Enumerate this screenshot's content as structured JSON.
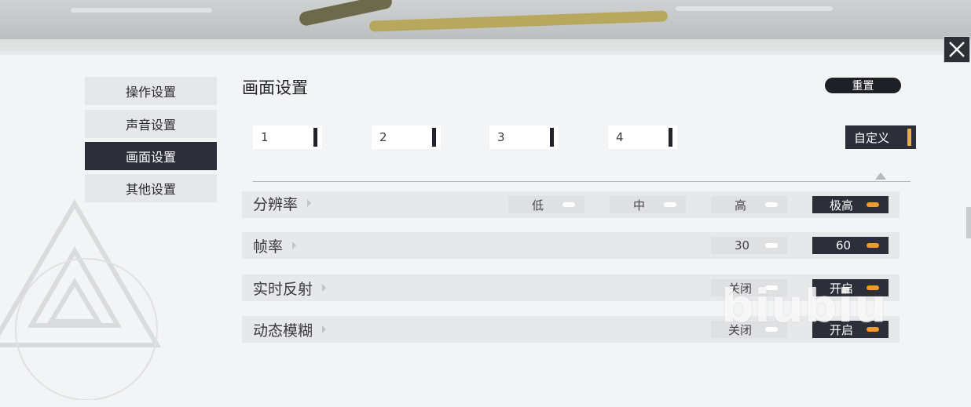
{
  "sidebar": {
    "items": [
      {
        "label": "操作设置",
        "active": false
      },
      {
        "label": "声音设置",
        "active": false
      },
      {
        "label": "画面设置",
        "active": true
      },
      {
        "label": "其他设置",
        "active": false
      }
    ]
  },
  "header": {
    "title": "画面设置",
    "reset_label": "重置"
  },
  "presets": {
    "items": [
      "1",
      "2",
      "3",
      "4"
    ],
    "custom_label": "自定义",
    "selected": "自定义"
  },
  "rows": [
    {
      "label": "分辨率",
      "options": [
        "低",
        "中",
        "高",
        "极高"
      ],
      "selected": "极高"
    },
    {
      "label": "帧率",
      "options": [
        "30",
        "60"
      ],
      "selected": "60"
    },
    {
      "label": "实时反射",
      "options": [
        "关闭",
        "开启"
      ],
      "selected": "开启"
    },
    {
      "label": "动态模糊",
      "options": [
        "关闭",
        "开启"
      ],
      "selected": "开启"
    }
  ],
  "watermark": "biubiu",
  "colors": {
    "accent": "#f09a2a",
    "custom_bar": "#e8b23a",
    "dark": "#2c2e3a",
    "panel": "#f3f4f5"
  },
  "icons": {
    "close": "close-icon",
    "row_arrow": "triangle-right-icon",
    "indicator": "triangle-up-icon"
  }
}
